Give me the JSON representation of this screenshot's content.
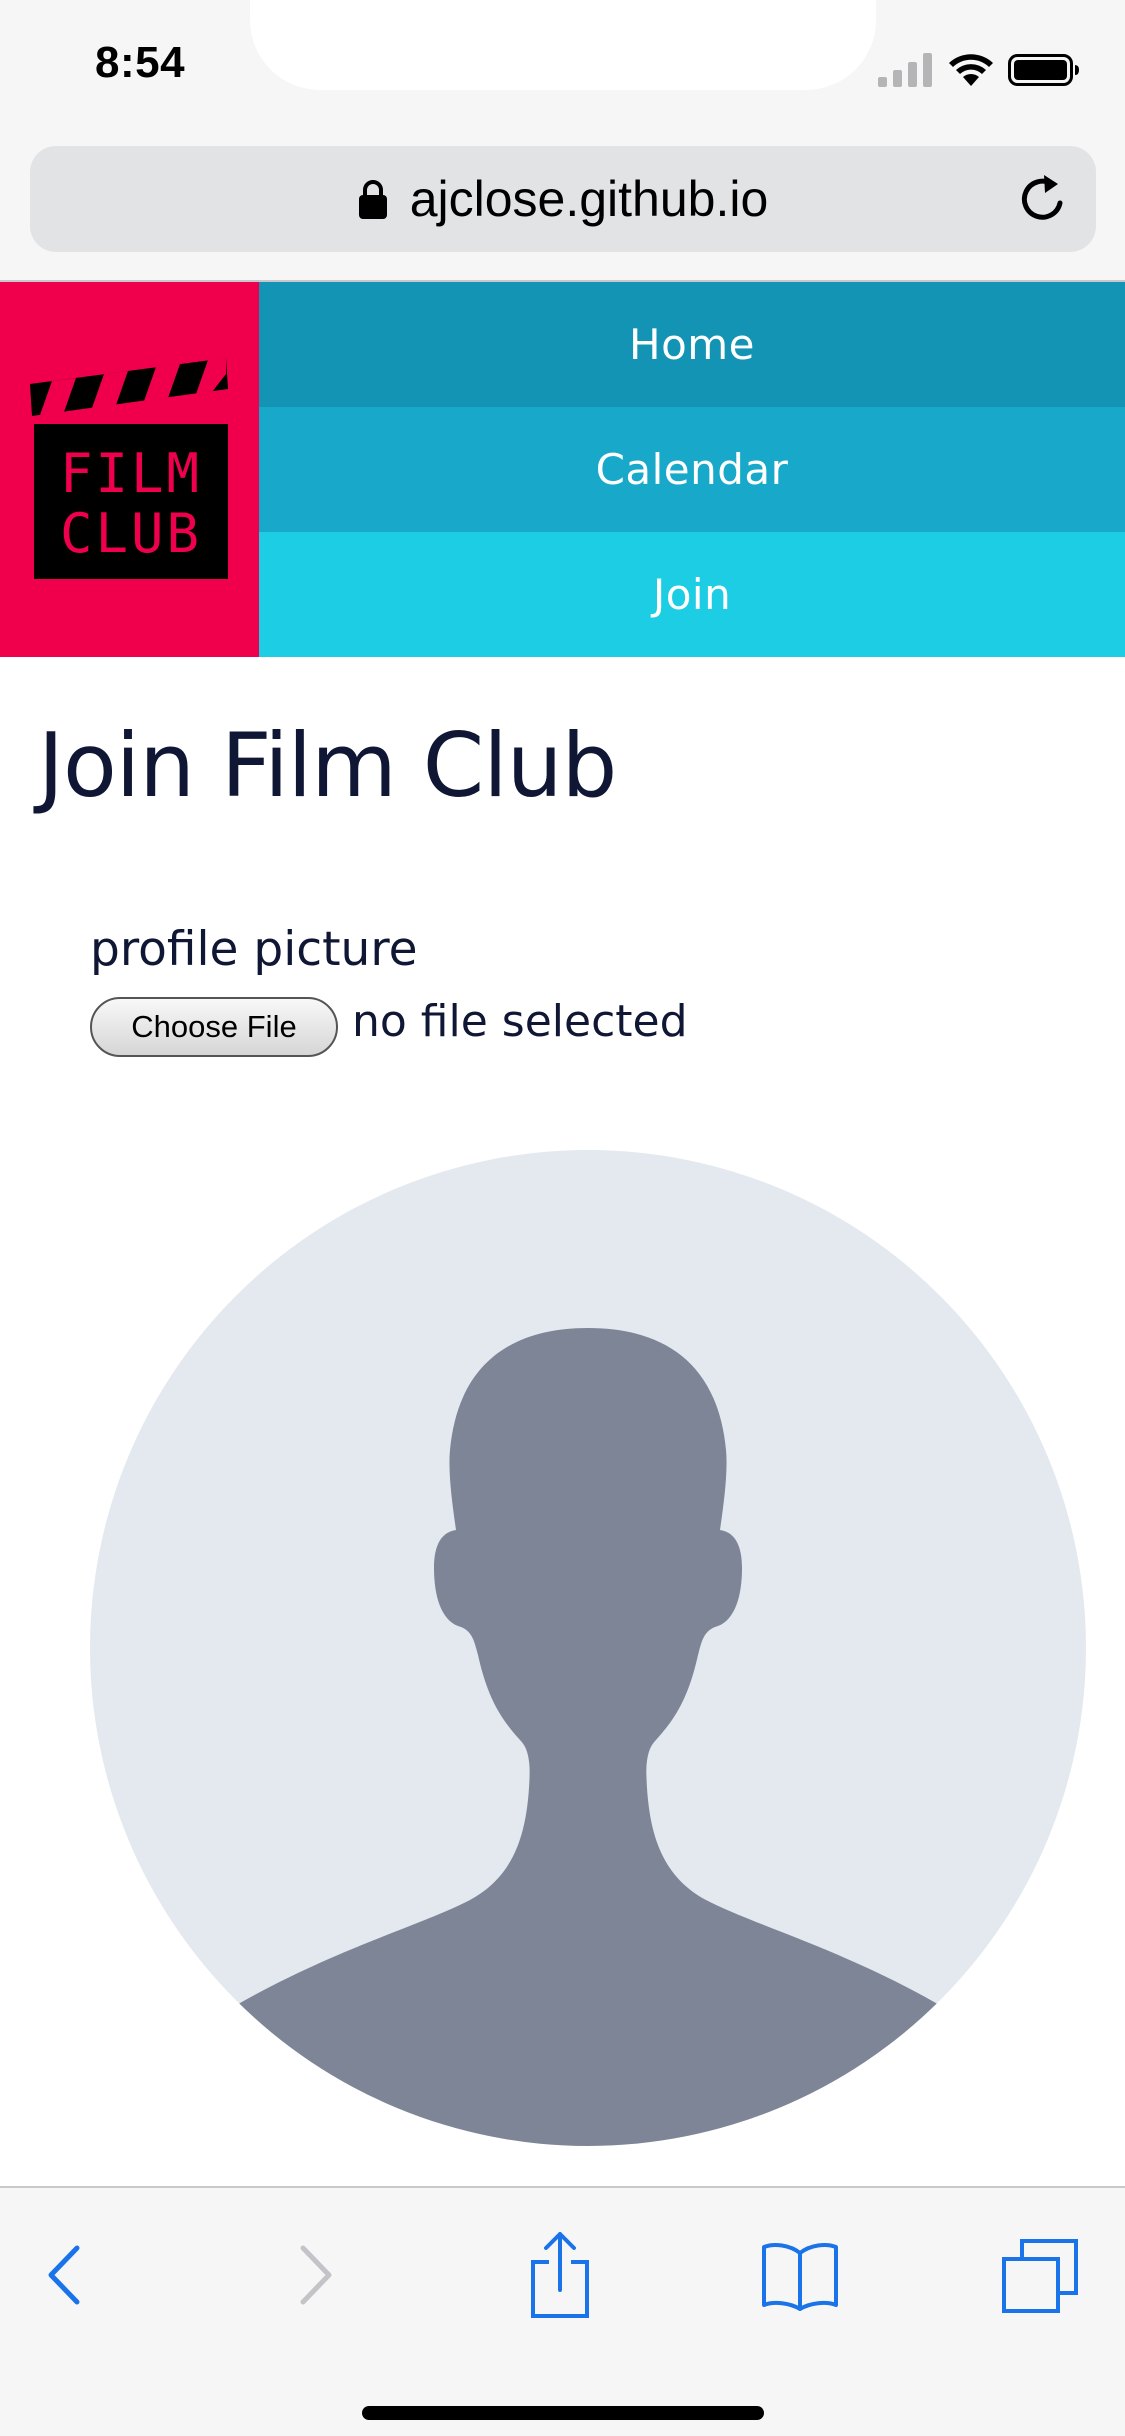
{
  "status_bar": {
    "time": "8:54",
    "icons": [
      "cellular-signal-icon",
      "wifi-icon",
      "battery-icon"
    ]
  },
  "browser": {
    "url": "ajclose.github.io",
    "secure_icon": "lock-icon",
    "reload_icon": "reload-icon",
    "toolbar": {
      "buttons": [
        "back-icon",
        "forward-icon",
        "share-icon",
        "bookmarks-icon",
        "tabs-icon"
      ]
    }
  },
  "site": {
    "logo": {
      "line1": "FILM",
      "line2": "CLUB"
    },
    "nav": {
      "home": "Home",
      "calendar": "Calendar",
      "join": "Join"
    },
    "page_title": "Join Film Club",
    "form": {
      "profile_label": "profile picture",
      "choose_file_label": "Choose File",
      "file_status": "no file selected"
    }
  },
  "colors": {
    "logo_bg": "#f0004c",
    "nav_home": "#1494b4",
    "nav_calendar": "#18a9ca",
    "nav_join": "#1ccde3",
    "text_dark": "#0f1735",
    "ios_blue": "#1a73e8",
    "avatar_bg": "#e4e9f0",
    "avatar_silhouette": "#7e8596"
  }
}
